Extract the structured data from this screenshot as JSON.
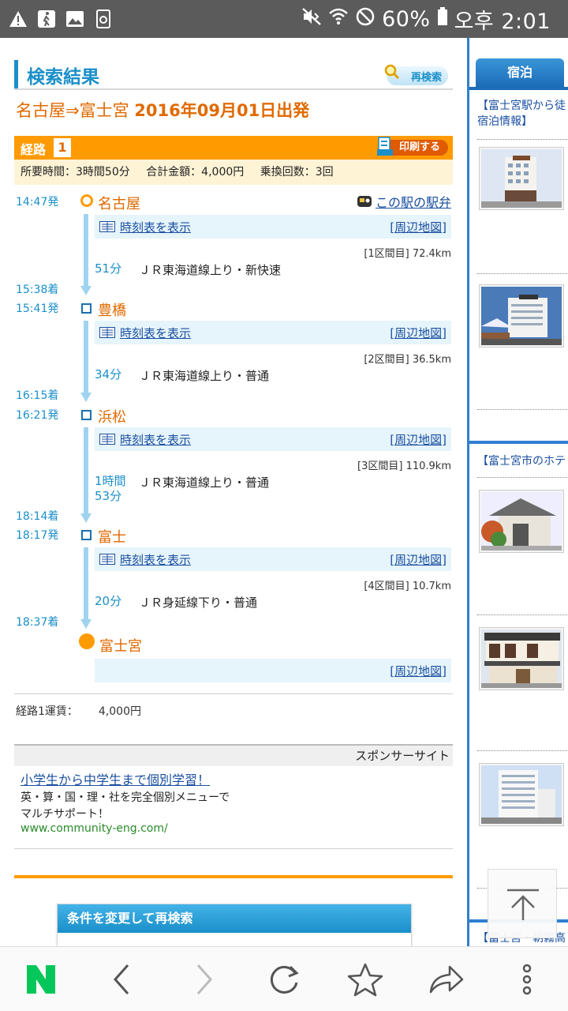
{
  "status_bar": {
    "battery": "60%",
    "time": "오후 2:01"
  },
  "header": {
    "title": "検索結果",
    "research_label": "再検索"
  },
  "route": {
    "title_plain": "名古屋⇒富士宮 ",
    "title_date": "2016年09月01日出発",
    "route_label": "経路",
    "route_number": "1",
    "print_label": "印刷する",
    "summary": {
      "duration": "所要時間：3時間50分",
      "fare": "合計金額：4,000円",
      "transfers": "乗換回数：3回"
    }
  },
  "common": {
    "timetable": "時刻表を表示",
    "map": "[周辺地図]",
    "bento": "この駅の駅弁"
  },
  "stations": [
    {
      "name": "名古屋",
      "depart": "14:47発"
    },
    {
      "name": "豊橋",
      "arrive": "15:38着",
      "depart": "15:41発"
    },
    {
      "name": "浜松",
      "arrive": "16:15着",
      "depart": "16:21発"
    },
    {
      "name": "富士",
      "arrive": "18:14着",
      "depart": "18:17発"
    },
    {
      "name": "富士宮",
      "arrive": "18:37着"
    }
  ],
  "segments": [
    {
      "distance": "[1区間目] 72.4km",
      "duration": "51分",
      "train": "ＪＲ東海道線上り・新快速"
    },
    {
      "distance": "[2区間目] 36.5km",
      "duration": "34分",
      "train": "ＪＲ東海道線上り・普通"
    },
    {
      "distance": "[3区間目] 110.9km",
      "duration_1": "1時間",
      "duration_2": "53分",
      "train": "ＪＲ東海道線上り・普通"
    },
    {
      "distance": "[4区間目] 10.7km",
      "duration": "20分",
      "train": "ＪＲ身延線下り・普通"
    }
  ],
  "fare": {
    "label": "経路1運賃：",
    "value": "4,000円"
  },
  "sponsor": {
    "label": "スポンサーサイト",
    "ad_title": "小学生から中学生まで個別学習！",
    "ad_line1": "英・算・国・理・社を完全個別メニューで",
    "ad_line2": "マルチサポート！",
    "ad_url": "www.community-eng.com/"
  },
  "research_box": {
    "title": "条件を変更して再検索"
  },
  "sidebar": {
    "tab": "宿泊",
    "block1_line1": "【富士宮駅から徒",
    "block1_line2": "宿泊情報】",
    "block2_line1": "【富士宮市のホテ",
    "block3_line1": "【富士宮・朝霧高"
  },
  "colors": {
    "accent_blue": "#1a8fc9",
    "accent_orange": "#ff9b00",
    "link_blue": "#1a4fa0",
    "naver_green": "#03c75a"
  }
}
